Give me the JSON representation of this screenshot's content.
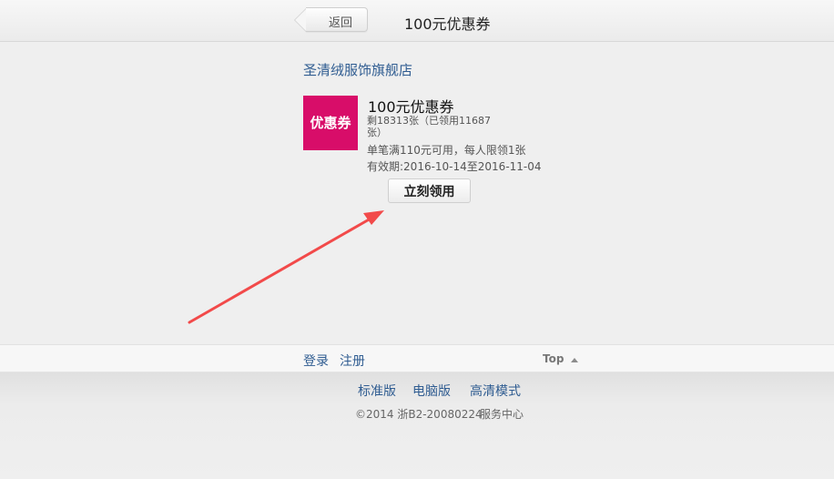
{
  "header": {
    "back_label": "返回",
    "title": "100元优惠券"
  },
  "store": {
    "name": "圣清绒服饰旗舰店"
  },
  "coupon": {
    "badge_text": "优惠券",
    "title": "100元优惠券",
    "remaining_text": "剩18313张（已领用11687张）",
    "rule_text": "单笔满110元可用，每人限领1张",
    "expiry_text": "有效期:2016-10-14至2016-11-04",
    "claim_button_label": "立刻领用"
  },
  "footer": {
    "login_label": "登录",
    "register_label": "注册",
    "top_label": "Top",
    "modes": {
      "standard": "标准版",
      "pc": "电脑版",
      "hd": "高清模式"
    },
    "copyright": "©2014 浙B2-20080224",
    "service_center": "服务中心"
  },
  "colors": {
    "accent_pink": "#d80d69",
    "link_blue": "#2f5c91",
    "annotation_red": "#f24a4a"
  },
  "icons": {
    "back": "back-arrow-icon",
    "top": "caret-up-icon",
    "annotation": "annotation-arrow-icon"
  }
}
